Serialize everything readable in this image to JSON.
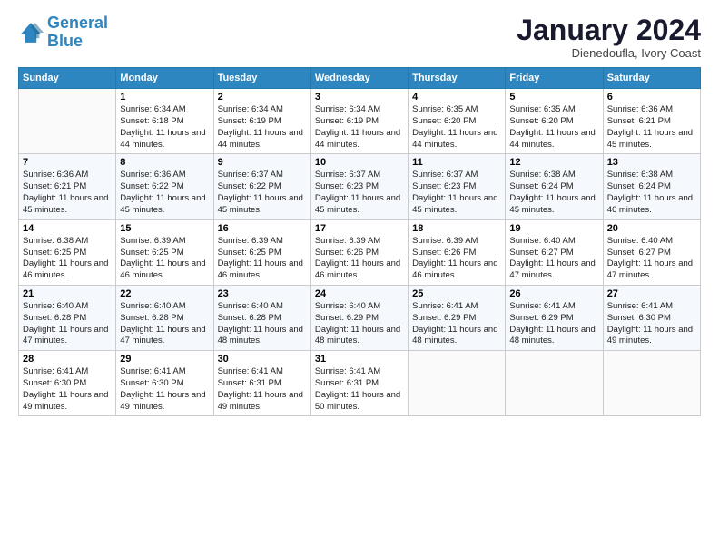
{
  "logo": {
    "line1": "General",
    "line2": "Blue"
  },
  "header": {
    "month": "January 2024",
    "location": "Dienedoufla, Ivory Coast"
  },
  "days_of_week": [
    "Sunday",
    "Monday",
    "Tuesday",
    "Wednesday",
    "Thursday",
    "Friday",
    "Saturday"
  ],
  "weeks": [
    [
      {
        "day": "",
        "info": ""
      },
      {
        "day": "1",
        "info": "Sunrise: 6:34 AM\nSunset: 6:18 PM\nDaylight: 11 hours and 44 minutes."
      },
      {
        "day": "2",
        "info": "Sunrise: 6:34 AM\nSunset: 6:19 PM\nDaylight: 11 hours and 44 minutes."
      },
      {
        "day": "3",
        "info": "Sunrise: 6:34 AM\nSunset: 6:19 PM\nDaylight: 11 hours and 44 minutes."
      },
      {
        "day": "4",
        "info": "Sunrise: 6:35 AM\nSunset: 6:20 PM\nDaylight: 11 hours and 44 minutes."
      },
      {
        "day": "5",
        "info": "Sunrise: 6:35 AM\nSunset: 6:20 PM\nDaylight: 11 hours and 44 minutes."
      },
      {
        "day": "6",
        "info": "Sunrise: 6:36 AM\nSunset: 6:21 PM\nDaylight: 11 hours and 45 minutes."
      }
    ],
    [
      {
        "day": "7",
        "info": "Sunrise: 6:36 AM\nSunset: 6:21 PM\nDaylight: 11 hours and 45 minutes."
      },
      {
        "day": "8",
        "info": "Sunrise: 6:36 AM\nSunset: 6:22 PM\nDaylight: 11 hours and 45 minutes."
      },
      {
        "day": "9",
        "info": "Sunrise: 6:37 AM\nSunset: 6:22 PM\nDaylight: 11 hours and 45 minutes."
      },
      {
        "day": "10",
        "info": "Sunrise: 6:37 AM\nSunset: 6:23 PM\nDaylight: 11 hours and 45 minutes."
      },
      {
        "day": "11",
        "info": "Sunrise: 6:37 AM\nSunset: 6:23 PM\nDaylight: 11 hours and 45 minutes."
      },
      {
        "day": "12",
        "info": "Sunrise: 6:38 AM\nSunset: 6:24 PM\nDaylight: 11 hours and 45 minutes."
      },
      {
        "day": "13",
        "info": "Sunrise: 6:38 AM\nSunset: 6:24 PM\nDaylight: 11 hours and 46 minutes."
      }
    ],
    [
      {
        "day": "14",
        "info": "Sunrise: 6:38 AM\nSunset: 6:25 PM\nDaylight: 11 hours and 46 minutes."
      },
      {
        "day": "15",
        "info": "Sunrise: 6:39 AM\nSunset: 6:25 PM\nDaylight: 11 hours and 46 minutes."
      },
      {
        "day": "16",
        "info": "Sunrise: 6:39 AM\nSunset: 6:25 PM\nDaylight: 11 hours and 46 minutes."
      },
      {
        "day": "17",
        "info": "Sunrise: 6:39 AM\nSunset: 6:26 PM\nDaylight: 11 hours and 46 minutes."
      },
      {
        "day": "18",
        "info": "Sunrise: 6:39 AM\nSunset: 6:26 PM\nDaylight: 11 hours and 46 minutes."
      },
      {
        "day": "19",
        "info": "Sunrise: 6:40 AM\nSunset: 6:27 PM\nDaylight: 11 hours and 47 minutes."
      },
      {
        "day": "20",
        "info": "Sunrise: 6:40 AM\nSunset: 6:27 PM\nDaylight: 11 hours and 47 minutes."
      }
    ],
    [
      {
        "day": "21",
        "info": "Sunrise: 6:40 AM\nSunset: 6:28 PM\nDaylight: 11 hours and 47 minutes."
      },
      {
        "day": "22",
        "info": "Sunrise: 6:40 AM\nSunset: 6:28 PM\nDaylight: 11 hours and 47 minutes."
      },
      {
        "day": "23",
        "info": "Sunrise: 6:40 AM\nSunset: 6:28 PM\nDaylight: 11 hours and 48 minutes."
      },
      {
        "day": "24",
        "info": "Sunrise: 6:40 AM\nSunset: 6:29 PM\nDaylight: 11 hours and 48 minutes."
      },
      {
        "day": "25",
        "info": "Sunrise: 6:41 AM\nSunset: 6:29 PM\nDaylight: 11 hours and 48 minutes."
      },
      {
        "day": "26",
        "info": "Sunrise: 6:41 AM\nSunset: 6:29 PM\nDaylight: 11 hours and 48 minutes."
      },
      {
        "day": "27",
        "info": "Sunrise: 6:41 AM\nSunset: 6:30 PM\nDaylight: 11 hours and 49 minutes."
      }
    ],
    [
      {
        "day": "28",
        "info": "Sunrise: 6:41 AM\nSunset: 6:30 PM\nDaylight: 11 hours and 49 minutes."
      },
      {
        "day": "29",
        "info": "Sunrise: 6:41 AM\nSunset: 6:30 PM\nDaylight: 11 hours and 49 minutes."
      },
      {
        "day": "30",
        "info": "Sunrise: 6:41 AM\nSunset: 6:31 PM\nDaylight: 11 hours and 49 minutes."
      },
      {
        "day": "31",
        "info": "Sunrise: 6:41 AM\nSunset: 6:31 PM\nDaylight: 11 hours and 50 minutes."
      },
      {
        "day": "",
        "info": ""
      },
      {
        "day": "",
        "info": ""
      },
      {
        "day": "",
        "info": ""
      }
    ]
  ]
}
